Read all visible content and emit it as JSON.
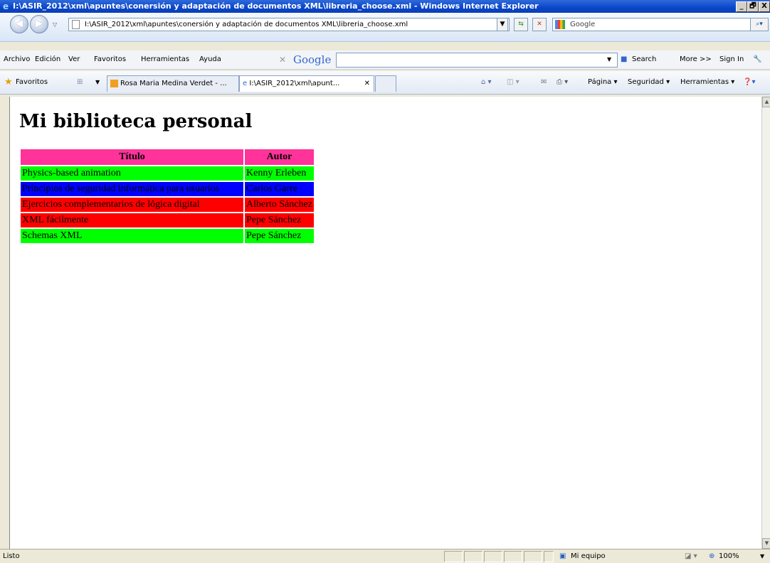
{
  "window": {
    "title": "I:\\ASIR_2012\\xml\\apuntes\\conersión y adaptación de documentos XML\\libreria_choose.xml - Windows Internet Explorer",
    "buttons": [
      "_",
      "🗗",
      "X"
    ]
  },
  "address_bar": {
    "url": "I:\\ASIR_2012\\xml\\apuntes\\conersión y adaptación de documentos XML\\libreria_choose.xml",
    "search_placeholder": "Google"
  },
  "menu": {
    "items": [
      "Archivo",
      "Edición",
      "Ver",
      "Favoritos",
      "Herramientas",
      "Ayuda"
    ],
    "google_toolbar": {
      "brand": "Google",
      "search_label": "Search",
      "more_label": "More >>",
      "signin_label": "Sign In"
    }
  },
  "favorites_bar": {
    "favorites_label": "Favoritos",
    "tabs": [
      {
        "label": "Rosa Maria Medina Verdet - ...",
        "active": false
      },
      {
        "label": "I:\\ASIR_2012\\xml\\apunt...",
        "active": true
      }
    ],
    "command_items": [
      "Página",
      "Seguridad",
      "Herramientas"
    ]
  },
  "page": {
    "heading": "Mi biblioteca personal",
    "table": {
      "headers": [
        "Título",
        "Autor"
      ],
      "rows": [
        {
          "titulo": "Physics-based animation",
          "autor": "Kenny Erleben",
          "bg": "#00FF00"
        },
        {
          "titulo": "Principios de seguridad informática para usuarios",
          "autor": "Carlos Garre",
          "bg": "#0000FF"
        },
        {
          "titulo": "Ejercicios complementarios de lógica digital",
          "autor": "Alberto Sánchez",
          "bg": "#FF0000"
        },
        {
          "titulo": "XML fácilmente",
          "autor": "Pepe Sánchez",
          "bg": "#FF0000"
        },
        {
          "titulo": "Schemas XML",
          "autor": "Pepe Sánchez",
          "bg": "#00FF00"
        }
      ],
      "header_bg": "#FF3399"
    }
  },
  "status_bar": {
    "text": "Listo",
    "zone": "Mi equipo",
    "zoom": "100%"
  }
}
